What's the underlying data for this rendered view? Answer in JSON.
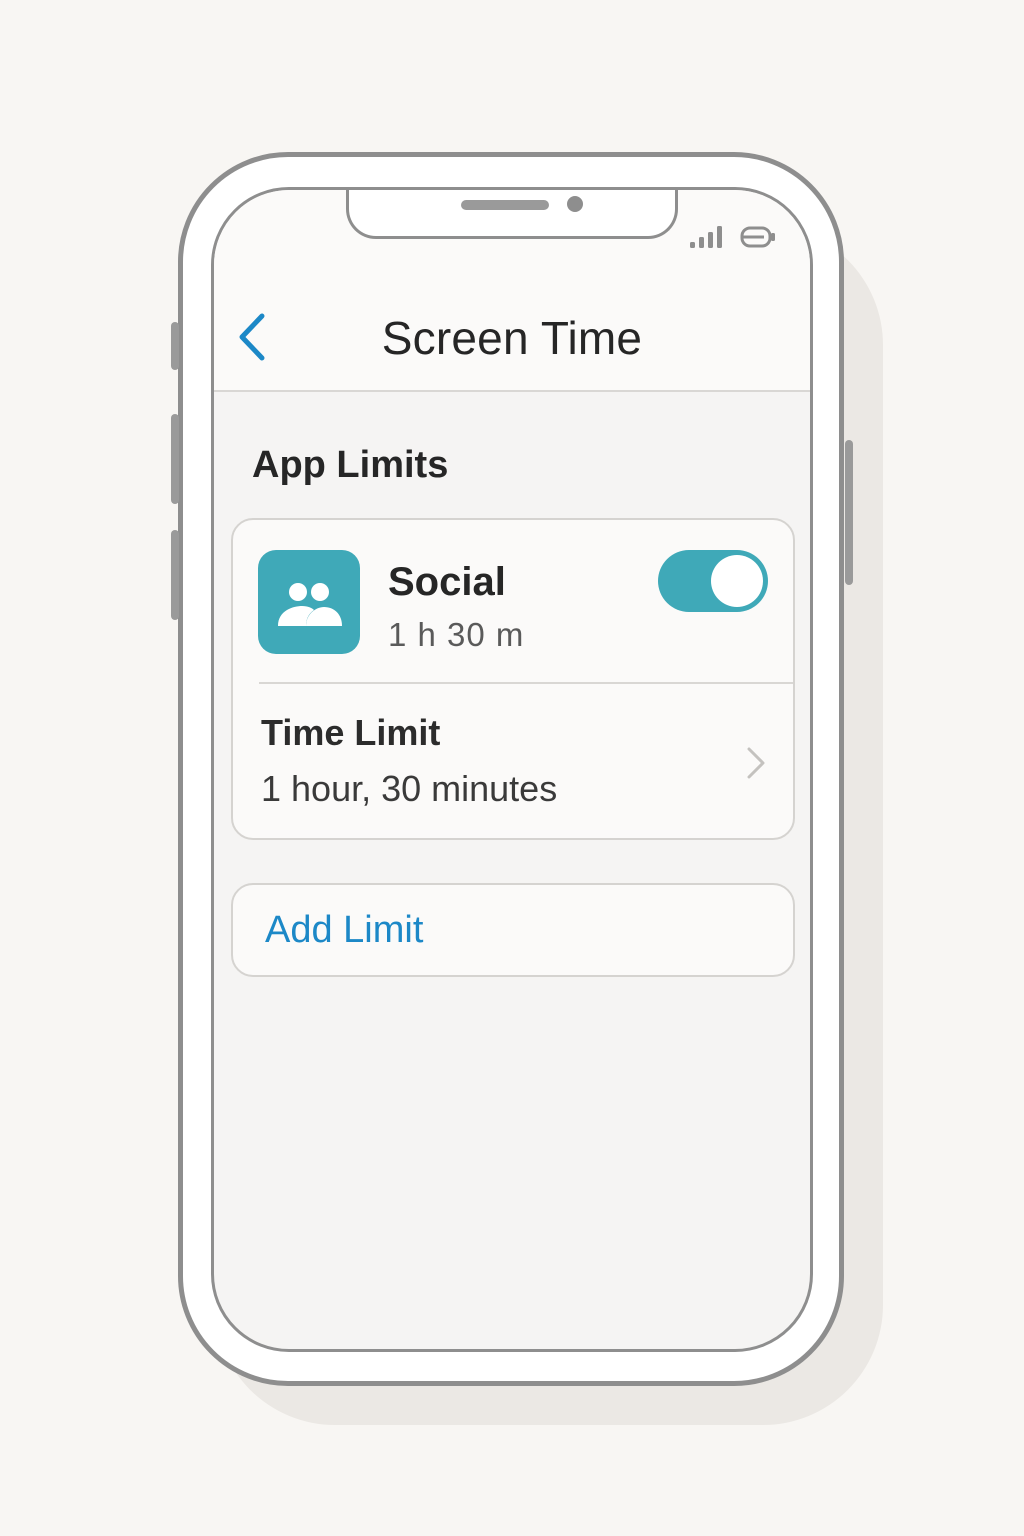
{
  "header": {
    "title": "Screen Time",
    "back_icon": "chevron-left-icon"
  },
  "status_bar": {
    "icons": [
      "signal-icon",
      "battery-icon"
    ]
  },
  "section": {
    "title": "App Limits"
  },
  "app_limit": {
    "icon": "people-icon",
    "name": "Social",
    "usage": "1 h 30 m",
    "enabled": true,
    "time_limit_label": "Time Limit",
    "time_limit_value": "1 hour, 30 minutes",
    "row_icon": "chevron-right-icon"
  },
  "add_limit": {
    "label": "Add Limit"
  },
  "colors": {
    "accent": "#3fa9b8",
    "link": "#1c88c7",
    "back": "#1c88c7",
    "frame": "#8e8e8e"
  }
}
